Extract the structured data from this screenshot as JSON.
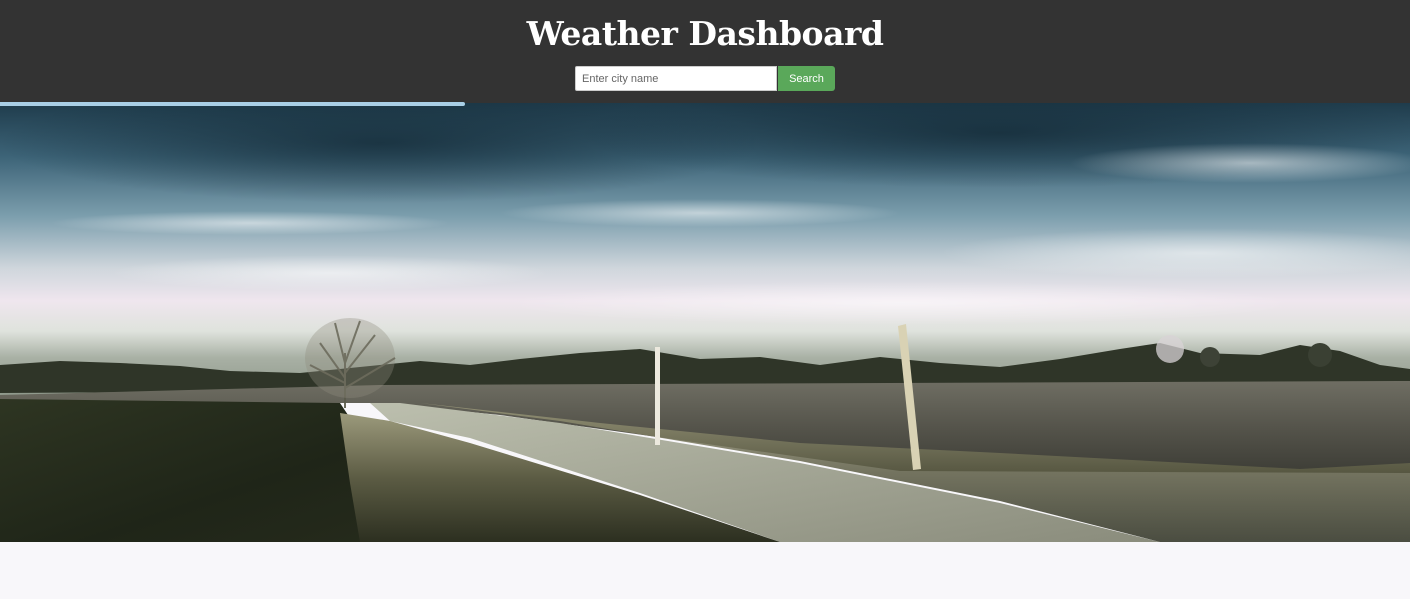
{
  "header": {
    "title": "Weather Dashboard",
    "background_color": "#333333"
  },
  "search": {
    "placeholder": "Enter city name",
    "value": "",
    "button_label": "Search",
    "button_color": "#5aa85a"
  },
  "progress": {
    "fraction": 0.33,
    "color": "#a9cfe6"
  },
  "hero": {
    "description_icon": "landscape-image"
  }
}
